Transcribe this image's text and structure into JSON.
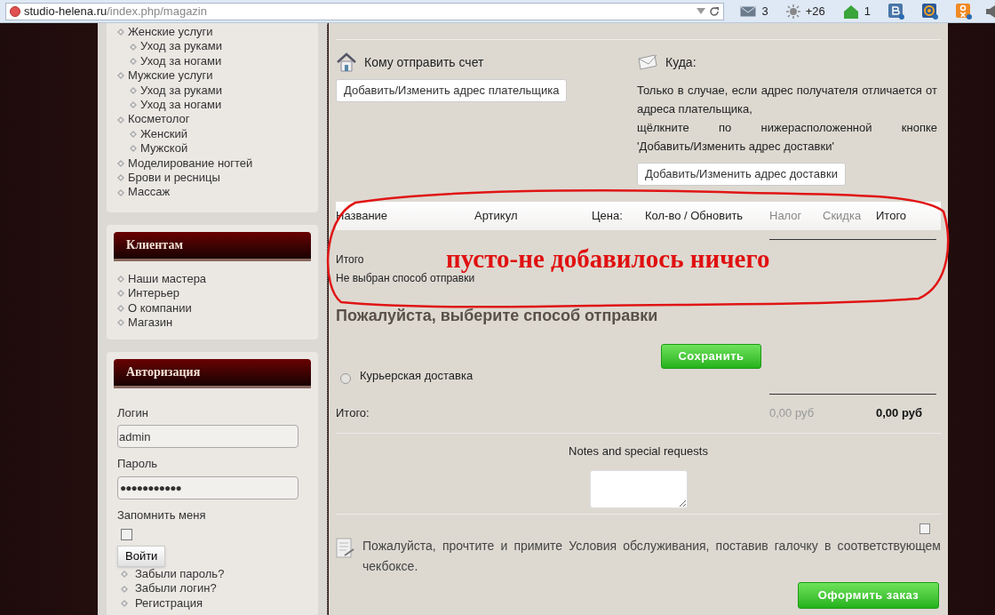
{
  "browser": {
    "url_host": "studio-helena.ru",
    "url_path": "/index.php/magazin",
    "toolbar": [
      {
        "kind": "mail",
        "text": "3"
      },
      {
        "kind": "weather",
        "text": "+26"
      },
      {
        "kind": "green",
        "text": "1"
      },
      {
        "kind": "vk"
      },
      {
        "kind": "at"
      },
      {
        "kind": "ok"
      }
    ]
  },
  "sidebar": {
    "menu": [
      {
        "label": "Женские услуги",
        "children": [
          {
            "label": "Уход за руками"
          },
          {
            "label": "Уход за ногами"
          }
        ]
      },
      {
        "label": "Мужские услуги",
        "children": [
          {
            "label": "Уход за руками"
          },
          {
            "label": "Уход за ногами"
          }
        ]
      },
      {
        "label": "Косметолог",
        "children": [
          {
            "label": "Женский"
          },
          {
            "label": "Мужской"
          }
        ]
      },
      {
        "label": "Моделирование ногтей"
      },
      {
        "label": "Брови и ресницы"
      },
      {
        "label": "Массаж"
      }
    ],
    "clients": {
      "title": "Клиентам",
      "items": [
        "Наши мастера",
        "Интерьер",
        "О компании",
        "Магазин"
      ]
    },
    "login": {
      "title": "Авторизация",
      "login_label": "Логин",
      "login_value": "admin",
      "password_label": "Пароль",
      "password_value": "●●●●●●●●●●●",
      "remember_label": "Запомнить меня",
      "remember_checked": false,
      "submit": "Войти",
      "links": [
        "Забыли пароль?",
        "Забыли логин?",
        "Регистрация"
      ]
    }
  },
  "main": {
    "billing": {
      "title": "Кому отправить счет",
      "button": "Добавить/Изменить адрес плательщика"
    },
    "shipping": {
      "title": "Куда:",
      "note_1": "Только в случае, если адрес получателя отличается от адреса плательщика,",
      "note_2": "щёлкните по нижерасположенной кнопке",
      "note_3": "'Добавить/Изменить адрес доставки'",
      "button": "Добавить/Изменить адрес доставки"
    },
    "table": {
      "columns": [
        {
          "label": "Название",
          "muted": false
        },
        {
          "label": "Артикул",
          "muted": false
        },
        {
          "label": "Цена:",
          "muted": false
        },
        {
          "label": "Кол-во / Обновить",
          "muted": false
        },
        {
          "label": "Налог",
          "muted": true
        },
        {
          "label": "Скидка",
          "muted": true
        },
        {
          "label": "Итого",
          "muted": false
        }
      ]
    },
    "cart_total_label": "Итого",
    "shipping_status": "Не выбран способ отправки",
    "annotation": "пусто-не добавилось ничего",
    "shipping_heading": "Пожалуйста, выберите способ отправки",
    "save_button": "Сохранить",
    "methods": [
      {
        "label": "Курьерская доставка",
        "selected": false
      }
    ],
    "total": {
      "label": "Итого:",
      "tax": "0,00 руб",
      "sum": "0,00 руб"
    },
    "notes_label": "Notes and special requests",
    "terms": {
      "text": "Пожалуйста, прочтите и примите Условия обслуживания, поставив галочку в соответствующем чекбоксе.",
      "checked": false
    },
    "checkout_button": "Оформить заказ"
  }
}
